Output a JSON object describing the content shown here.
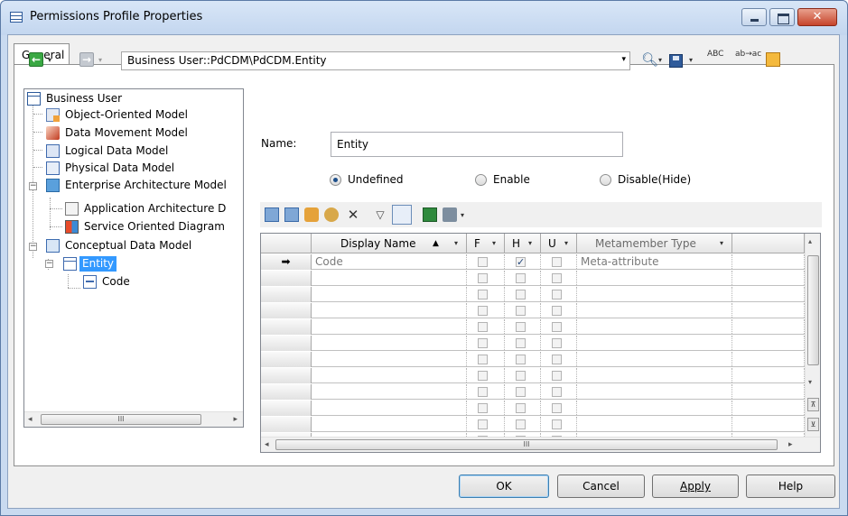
{
  "window": {
    "title": "Permissions Profile Properties",
    "close_symbol": "✕"
  },
  "tabs": [
    {
      "label": "General"
    }
  ],
  "toolbar": {
    "path": "Business User::PdCDM\\PdCDM.Entity",
    "spell_label": "ABC",
    "replace_label": "ab→ac",
    "dropdown_symbol": "▾"
  },
  "tree": {
    "nodes": [
      {
        "label": "Business User",
        "icon": "business-user-icon"
      },
      {
        "label": "Object-Oriented Model",
        "icon": "object-oriented-model-icon"
      },
      {
        "label": "Data Movement Model",
        "icon": "data-movement-model-icon"
      },
      {
        "label": "Logical Data Model",
        "icon": "logical-data-model-icon"
      },
      {
        "label": "Physical Data Model",
        "icon": "physical-data-model-icon"
      },
      {
        "label": "Enterprise Architecture Model",
        "icon": "enterprise-architecture-model-icon"
      },
      {
        "label": "Application Architecture D",
        "icon": "application-architecture-diagram-icon"
      },
      {
        "label": "Service Oriented Diagram",
        "icon": "service-oriented-diagram-icon"
      },
      {
        "label": "Conceptual Data Model",
        "icon": "conceptual-data-model-icon"
      },
      {
        "label": "Entity",
        "icon": "entity-icon"
      },
      {
        "label": "Code",
        "icon": "code-icon"
      }
    ],
    "expand_symbol": "+",
    "collapse_symbol": "−",
    "scroll_left": "◂",
    "scroll_right": "▸",
    "scroll_grip": "III"
  },
  "form": {
    "name_label": "Name:",
    "name_value": "Entity",
    "radios": [
      {
        "label": "Undefined",
        "checked": true
      },
      {
        "label": "Enable",
        "checked": false
      },
      {
        "label": "Disable(Hide)",
        "checked": false
      }
    ]
  },
  "grid": {
    "columns": [
      "Display Name",
      "F",
      "H",
      "U",
      "Metamember Type"
    ],
    "sort_symbol": "▲",
    "filter_symbol": "▾",
    "current_row_marker": "➡",
    "rows": [
      {
        "name": "Code",
        "F": false,
        "H": true,
        "U": false,
        "type": "Meta-attribute"
      },
      {
        "name": "",
        "F": false,
        "H": false,
        "U": false,
        "type": ""
      },
      {
        "name": "",
        "F": false,
        "H": false,
        "U": false,
        "type": ""
      },
      {
        "name": "",
        "F": false,
        "H": false,
        "U": false,
        "type": ""
      },
      {
        "name": "",
        "F": false,
        "H": false,
        "U": false,
        "type": ""
      },
      {
        "name": "",
        "F": false,
        "H": false,
        "U": false,
        "type": ""
      },
      {
        "name": "",
        "F": false,
        "H": false,
        "U": false,
        "type": ""
      },
      {
        "name": "",
        "F": false,
        "H": false,
        "U": false,
        "type": ""
      },
      {
        "name": "",
        "F": false,
        "H": false,
        "U": false,
        "type": ""
      },
      {
        "name": "",
        "F": false,
        "H": false,
        "U": false,
        "type": ""
      },
      {
        "name": "",
        "F": false,
        "H": false,
        "U": false,
        "type": ""
      },
      {
        "name": "",
        "F": false,
        "H": false,
        "U": false,
        "type": ""
      }
    ],
    "scroll_grip": "III",
    "scroll_up": "▴",
    "scroll_down": "▾",
    "page_top": "⊼",
    "page_bottom": "⊻"
  },
  "buttons": {
    "ok": "OK",
    "cancel": "Cancel",
    "apply": "Apply",
    "help": "Help"
  }
}
